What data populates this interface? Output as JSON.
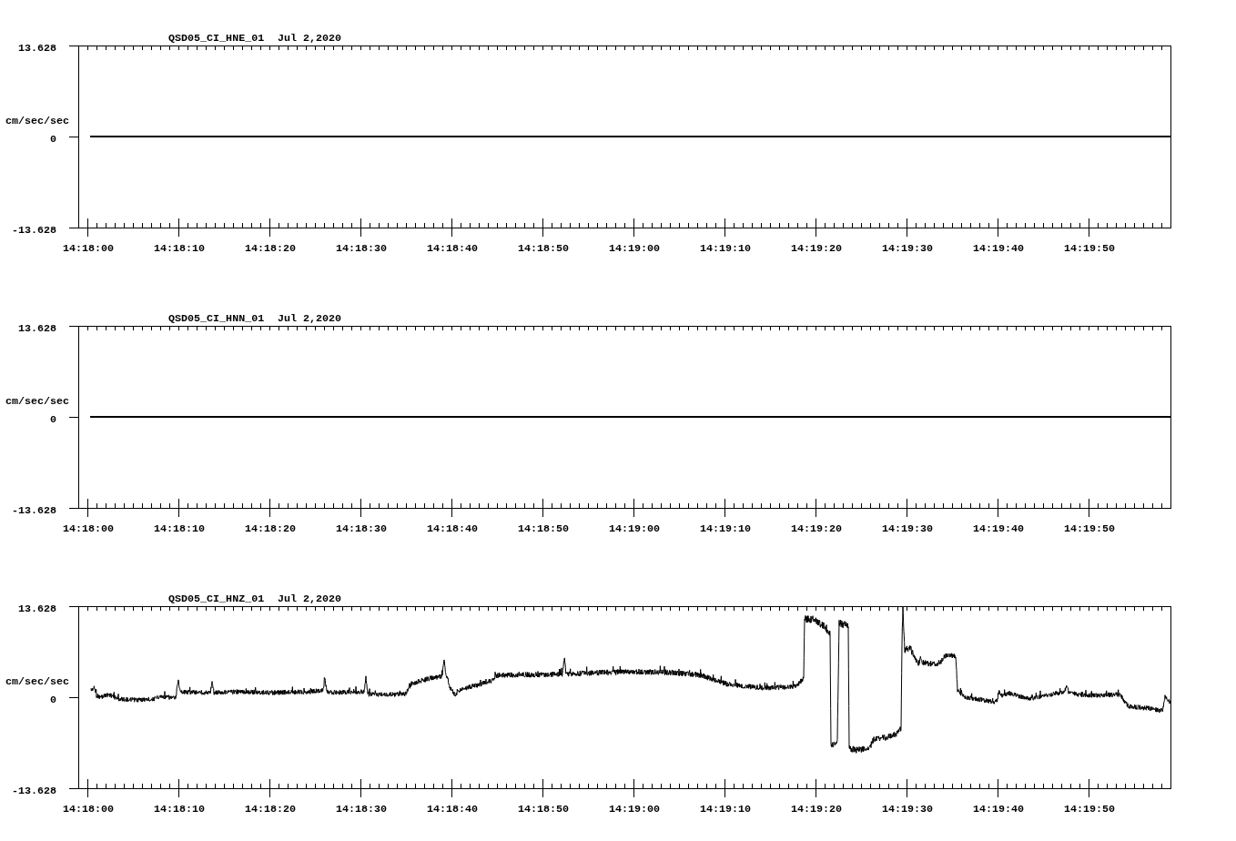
{
  "panels": [
    {
      "kind": "flat",
      "station": "QSD05_CI_HNE_01",
      "date": "Jul 2,2020",
      "y_axis": {
        "label": "cm/sec/sec",
        "ticks": [
          "13.628",
          "0",
          "-13.628"
        ]
      },
      "x_axis": {
        "ticks": [
          "14:18:00",
          "14:18:10",
          "14:18:20",
          "14:18:30",
          "14:18:40",
          "14:18:50",
          "14:19:00",
          "14:19:10",
          "14:19:20",
          "14:19:30",
          "14:19:40",
          "14:19:50"
        ]
      }
    },
    {
      "kind": "flat",
      "station": "QSD05_CI_HNN_01",
      "date": "Jul 2,2020",
      "y_axis": {
        "label": "cm/sec/sec",
        "ticks": [
          "13.628",
          "0",
          "-13.628"
        ]
      },
      "x_axis": {
        "ticks": [
          "14:18:00",
          "14:18:10",
          "14:18:20",
          "14:18:30",
          "14:18:40",
          "14:18:50",
          "14:19:00",
          "14:19:10",
          "14:19:20",
          "14:19:30",
          "14:19:40",
          "14:19:50"
        ]
      }
    },
    {
      "kind": "waveform",
      "station": "QSD05_CI_HNZ_01",
      "date": "Jul 2,2020",
      "y_axis": {
        "label": "cm/sec/sec",
        "ticks": [
          "13.628",
          "0",
          "-13.628"
        ]
      },
      "x_axis": {
        "ticks": [
          "14:18:00",
          "14:18:10",
          "14:18:20",
          "14:18:30",
          "14:18:40",
          "14:18:50",
          "14:19:00",
          "14:19:10",
          "14:19:20",
          "14:19:30",
          "14:19:40",
          "14:19:50"
        ]
      }
    }
  ]
}
